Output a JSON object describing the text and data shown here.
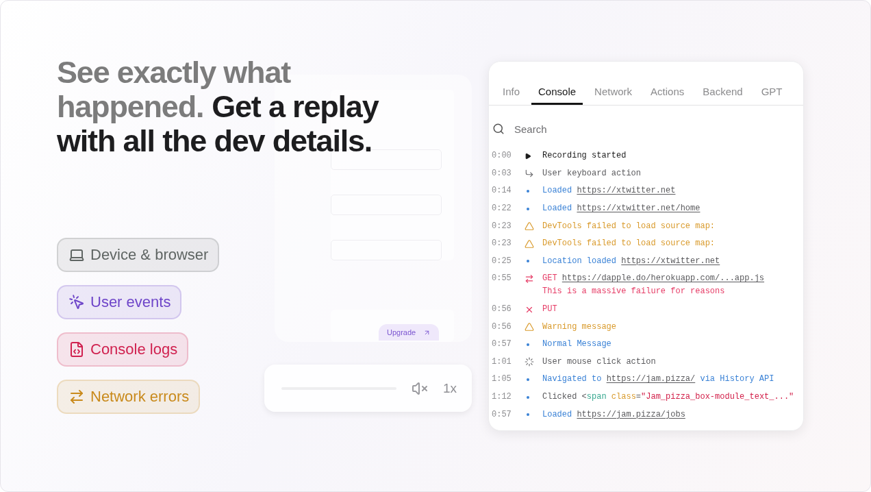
{
  "headline": {
    "lines": [
      [
        {
          "text": "See exactly what",
          "kind": "lead"
        }
      ],
      [
        {
          "text": "happened.",
          "kind": "lead"
        },
        {
          "text": "Get a replay",
          "kind": "main"
        }
      ],
      [
        {
          "text": "with all the dev details.",
          "kind": "main"
        }
      ]
    ]
  },
  "features": [
    {
      "kind": "device",
      "label": "Device & browser",
      "color": "#5f6563"
    },
    {
      "kind": "events",
      "label": "User events",
      "color": "#6e45c9"
    },
    {
      "kind": "console",
      "label": "Console logs",
      "color": "#d0214f"
    },
    {
      "kind": "network",
      "label": "Network errors",
      "color": "#c98a1c"
    }
  ],
  "replay_preview": {
    "upgrade_label": "Upgrade",
    "speed": "1x",
    "muted": true
  },
  "devtools": {
    "tabs": [
      {
        "label": "Info",
        "selected": false
      },
      {
        "label": "Console",
        "selected": true
      },
      {
        "label": "Network",
        "selected": false
      },
      {
        "label": "Actions",
        "selected": false
      },
      {
        "label": "Backend",
        "selected": false
      },
      {
        "label": "GPT",
        "selected": false
      }
    ],
    "search": {
      "placeholder": "Search"
    },
    "entries": [
      {
        "time": "0:00",
        "kind": "start",
        "parts": [
          {
            "text": "Recording started",
            "kind": "dark"
          }
        ]
      },
      {
        "time": "0:03",
        "kind": "keyboard",
        "parts": [
          {
            "text": "User keyboard action",
            "kind": "plain"
          }
        ]
      },
      {
        "time": "0:14",
        "kind": "info",
        "parts": [
          {
            "text": "Loaded",
            "kind": "info"
          },
          {
            "text": "https://xtwitter.net",
            "kind": "link"
          }
        ]
      },
      {
        "time": "0:22",
        "kind": "info",
        "parts": [
          {
            "text": "Loaded",
            "kind": "info"
          },
          {
            "text": "https://xtwitter.net/home",
            "kind": "link"
          }
        ]
      },
      {
        "time": "0:23",
        "kind": "warning",
        "parts": [
          {
            "text": "DevTools failed to load source map:",
            "kind": "warn"
          }
        ]
      },
      {
        "time": "0:23",
        "kind": "warning",
        "parts": [
          {
            "text": "DevTools failed to load source map:",
            "kind": "warn"
          }
        ]
      },
      {
        "time": "0:25",
        "kind": "info",
        "parts": [
          {
            "text": "Location loaded",
            "kind": "info"
          },
          {
            "text": "https://xtwitter.net",
            "kind": "link"
          }
        ]
      },
      {
        "time": "0:55",
        "kind": "network",
        "parts": [
          {
            "text": "GET",
            "kind": "error"
          },
          {
            "text": "https://dapple.do/herokuapp.com/...app.js",
            "kind": "link"
          }
        ],
        "detail": "This is a massive failure for reasons"
      },
      {
        "time": "0:56",
        "kind": "error",
        "parts": [
          {
            "text": "PUT",
            "kind": "error"
          }
        ]
      },
      {
        "time": "0:56",
        "kind": "warning",
        "parts": [
          {
            "text": "Warning message",
            "kind": "warn"
          }
        ]
      },
      {
        "time": "0:57",
        "kind": "info",
        "parts": [
          {
            "text": "Normal Message",
            "kind": "info"
          }
        ]
      },
      {
        "time": "1:01",
        "kind": "click",
        "parts": [
          {
            "text": "User mouse click action",
            "kind": "plain"
          }
        ]
      },
      {
        "time": "1:05",
        "kind": "info",
        "parts": [
          {
            "text": "Navigated to",
            "kind": "info"
          },
          {
            "text": "https://jam.pizza/",
            "kind": "link"
          },
          {
            "text": "via History API",
            "kind": "info"
          }
        ]
      },
      {
        "time": "1:12",
        "kind": "info",
        "parts": [
          {
            "text": "Clicked <",
            "kind": "plain"
          },
          {
            "text": "span",
            "kind": "tag"
          },
          {
            "text": "class",
            "kind": "attr"
          },
          {
            "text": "=",
            "kind": "plain"
          },
          {
            "text": "\"Jam_pizza_box-module_text_...\"",
            "kind": "string"
          }
        ]
      },
      {
        "time": "0:57",
        "kind": "info",
        "parts": [
          {
            "text": "Loaded",
            "kind": "info"
          },
          {
            "text": "https://jam.pizza/jobs",
            "kind": "link"
          }
        ]
      }
    ]
  }
}
